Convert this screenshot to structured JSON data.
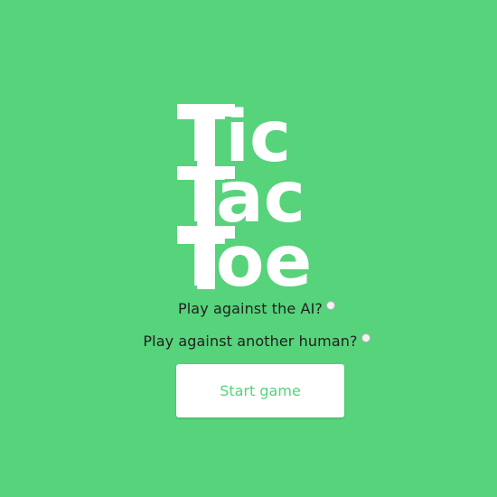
{
  "title": {
    "line1": "Tic",
    "line2": "Tac",
    "line3": "Toe"
  },
  "options": {
    "ai_label": "Play against the AI?",
    "human_label": "Play against another human?"
  },
  "start_button": {
    "label": "Start game"
  },
  "colors": {
    "background": "#56d37b",
    "title": "#ffffff",
    "button_text": "#56d37b"
  }
}
